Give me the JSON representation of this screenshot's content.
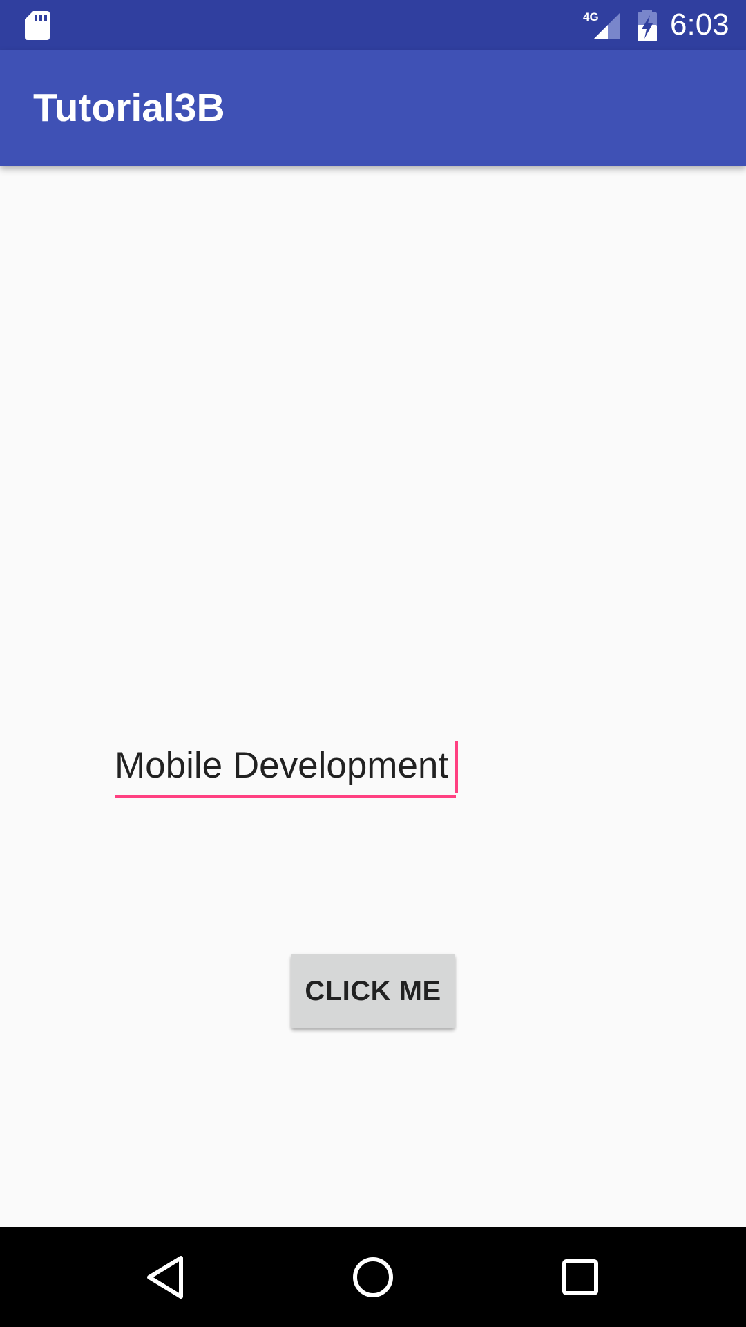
{
  "status_bar": {
    "network_type": "4G",
    "time": "6:03",
    "icons": [
      "sd-card-icon",
      "cell-signal-icon",
      "battery-charging-icon"
    ],
    "background_color": "#303f9f"
  },
  "app_bar": {
    "title": "Tutorial3B",
    "background_color": "#3f51b5"
  },
  "main": {
    "text_field": {
      "value": "Mobile Development",
      "accent_color": "#ff4081"
    },
    "button": {
      "label": "CLICK ME"
    }
  },
  "nav_bar": {
    "icons": [
      "back-icon",
      "home-icon",
      "recents-icon"
    ]
  }
}
